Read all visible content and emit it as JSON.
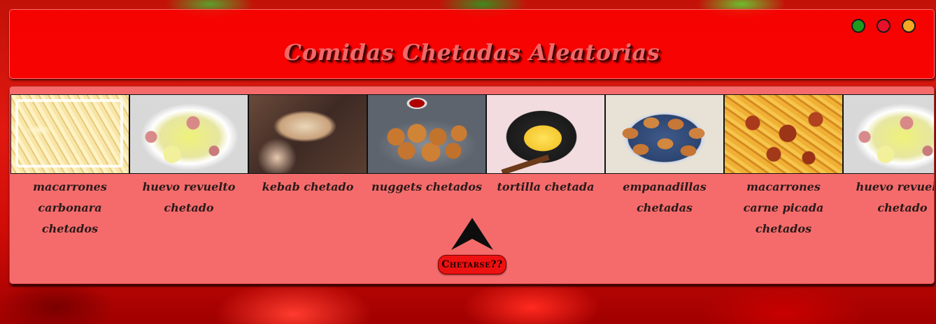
{
  "header": {
    "title": "Comidas Chetadas Aleatorias",
    "window_controls": [
      {
        "name": "green-dot",
        "color": "#1e9a1e"
      },
      {
        "name": "red-dot",
        "color": "#e8102a"
      },
      {
        "name": "orange-dot",
        "color": "#f5a623"
      }
    ]
  },
  "foods": [
    {
      "caption": "macarrones carbonara chetados",
      "image": "pasta-carbonara-image"
    },
    {
      "caption": "huevo revuelto chetado",
      "image": "scrambled-egg-image"
    },
    {
      "caption": "kebab chetado",
      "image": "kebab-image"
    },
    {
      "caption": "nuggets chetados",
      "image": "nuggets-image"
    },
    {
      "caption": "tortilla chetada",
      "image": "tortilla-image"
    },
    {
      "caption": "empanadillas chetadas",
      "image": "empanadillas-image"
    },
    {
      "caption": "macarrones carne picada chetados",
      "image": "pasta-meat-image"
    },
    {
      "caption": "huevo revuelto chetado",
      "image": "scrambled-egg-image"
    }
  ],
  "action": {
    "arrow_icon": "up-arrow-icon",
    "button_label": "Chetarse??"
  },
  "colors": {
    "header_bg": "#ff0000",
    "panel_bg": "#f56b6b",
    "button_bg": "#ee1111",
    "title_color": "#f06868"
  }
}
